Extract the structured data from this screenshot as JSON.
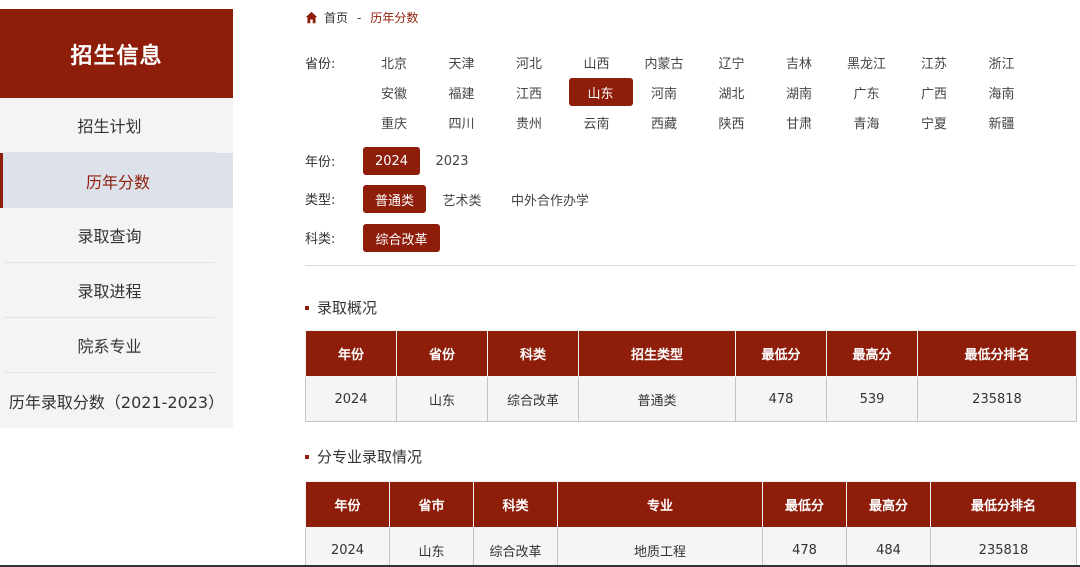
{
  "sidebar": {
    "title": "招生信息",
    "items": [
      {
        "label": "招生计划"
      },
      {
        "label": "历年分数"
      },
      {
        "label": "录取查询"
      },
      {
        "label": "录取进程"
      },
      {
        "label": "院系专业"
      },
      {
        "label": "历年录取分数（2021-2023）"
      }
    ]
  },
  "breadcrumb": {
    "home": "首页",
    "separator": "-",
    "current": "历年分数"
  },
  "filters": {
    "province_label": "省份:",
    "provinces": [
      "北京",
      "天津",
      "河北",
      "山西",
      "内蒙古",
      "辽宁",
      "吉林",
      "黑龙江",
      "江苏",
      "浙江",
      "安徽",
      "福建",
      "江西",
      "山东",
      "河南",
      "湖北",
      "湖南",
      "广东",
      "广西",
      "海南",
      "重庆",
      "四川",
      "贵州",
      "云南",
      "西藏",
      "陕西",
      "甘肃",
      "青海",
      "宁夏",
      "新疆"
    ],
    "province_selected": "山东",
    "year_label": "年份:",
    "years": [
      "2024",
      "2023"
    ],
    "type_label": "类型:",
    "types": [
      "普通类",
      "艺术类",
      "中外合作办学"
    ],
    "subject_label": "科类:",
    "subjects": [
      "综合改革"
    ]
  },
  "overview": {
    "title": "录取概况",
    "headers": [
      "年份",
      "省份",
      "科类",
      "招生类型",
      "最低分",
      "最高分",
      "最低分排名"
    ],
    "rows": [
      [
        "2024",
        "山东",
        "综合改革",
        "普通类",
        "478",
        "539",
        "235818"
      ]
    ]
  },
  "major": {
    "title": "分专业录取情况",
    "headers": [
      "年份",
      "省市",
      "科类",
      "专业",
      "最低分",
      "最高分",
      "最低分排名"
    ],
    "rows": [
      [
        "2024",
        "山东",
        "综合改革",
        "地质工程",
        "478",
        "484",
        "235818"
      ]
    ]
  },
  "colors": {
    "accent": "#8e1d0a",
    "sidebar_bg": "#f4f4f4",
    "active_bg": "#dde2ea"
  }
}
